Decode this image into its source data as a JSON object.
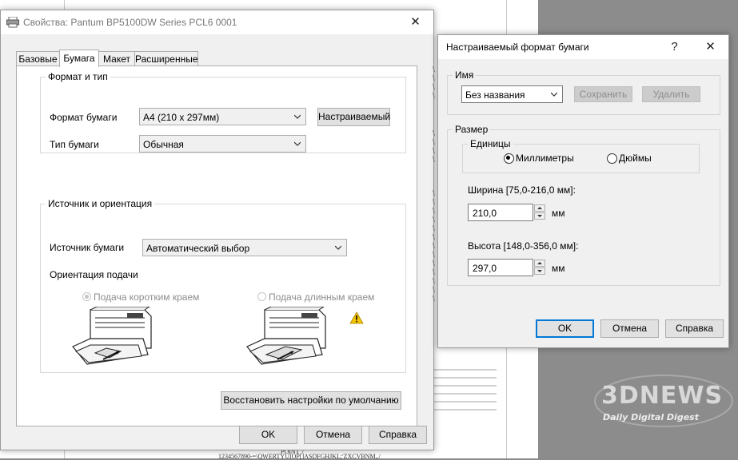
{
  "background_doc": {
    "footer_text_1": "POINT 7",
    "footer_text_2": "1234567890-=\\QWERTYUIOP[]ASDFGHJKL;'ZXCVBNM,./"
  },
  "main_window": {
    "title": "Свойства: Pantum BP5100DW Series PCL6 0001",
    "close_glyph": "✕",
    "tabs": [
      {
        "label": "Базовые"
      },
      {
        "label": "Бумага"
      },
      {
        "label": "Макет"
      },
      {
        "label": "Расширенные"
      }
    ],
    "format_group": {
      "title": "Формат и тип",
      "paper_format_label": "Формат бумаги",
      "paper_format_value": "A4 (210 x 297мм)",
      "custom_button": "Настраиваемый",
      "paper_type_label": "Тип бумаги",
      "paper_type_value": "Обычная"
    },
    "source_group": {
      "title": "Источник и ориентация",
      "source_label": "Источник бумаги",
      "source_value": "Автоматический выбор",
      "orientation_label": "Ориентация подачи",
      "short_edge_label": "Подача коротким краем",
      "long_edge_label": "Подача длинным краем",
      "short_edge_selected": true
    },
    "restore_defaults_button": "Восстановить настройки по умолчанию",
    "ok_button": "OK",
    "cancel_button": "Отмена",
    "help_button": "Справка"
  },
  "custom_dialog": {
    "title": "Настраиваемый формат бумаги",
    "help_glyph": "?",
    "close_glyph": "✕",
    "name_group": {
      "title": "Имя",
      "name_value": "Без названия",
      "save_button": "Сохранить",
      "delete_button": "Удалить"
    },
    "size_group": {
      "title": "Размер",
      "units_title": "Единицы",
      "mm_label": "Миллиметры",
      "inch_label": "Дюймы",
      "mm_selected": true,
      "width_label": "Ширина [75,0-216,0 мм]:",
      "width_value": "210,0",
      "width_unit": "мм",
      "height_label": "Высота [148,0-356,0 мм]:",
      "height_value": "297,0",
      "height_unit": "мм"
    },
    "ok_button": "OK",
    "cancel_button": "Отмена",
    "help_button": "Справка"
  },
  "watermark": {
    "logo_text": "3DNEWS",
    "tagline": "Daily Digital Digest"
  },
  "colors": {
    "accent": "#0078d7",
    "warning": "#f5c400"
  }
}
